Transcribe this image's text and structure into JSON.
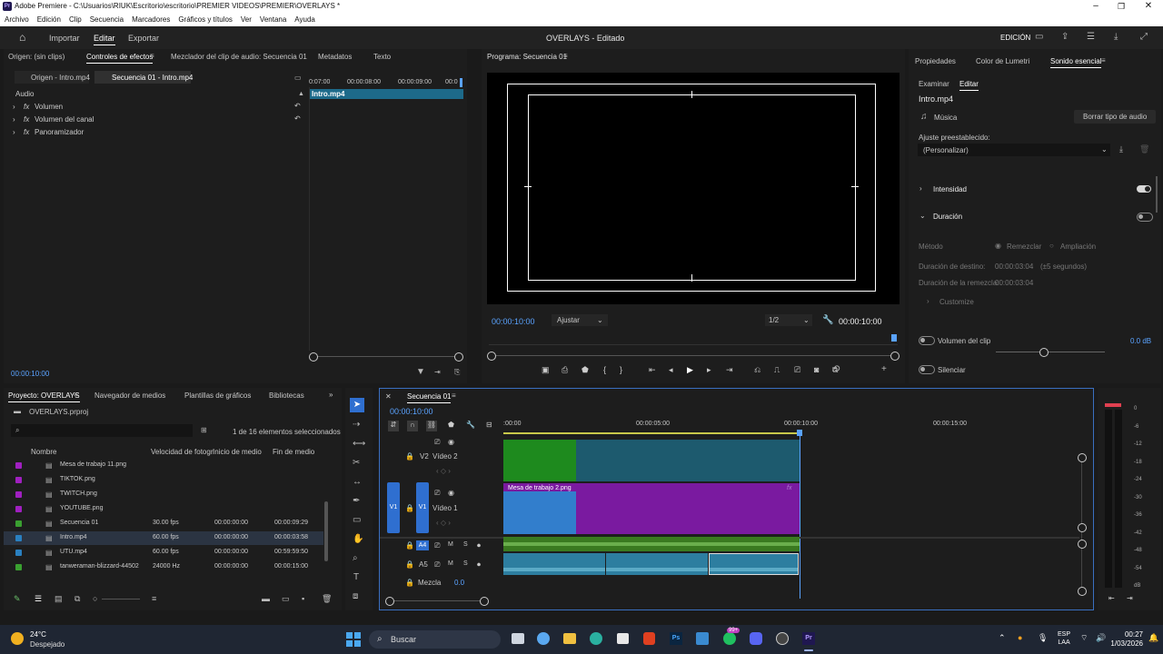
{
  "window": {
    "title": "Adobe Premiere - C:\\Usuarios\\RIUK\\Escritorio\\escritorio\\PREMIER VIDEOS\\PREMIER\\OVERLAYS *",
    "app_icon": "Pr"
  },
  "menu": [
    "Archivo",
    "Edición",
    "Clip",
    "Secuencia",
    "Marcadores",
    "Gráficos y títulos",
    "Ver",
    "Ventana",
    "Ayuda"
  ],
  "header": {
    "home_icon": "home-icon",
    "modes": [
      "Importar",
      "Editar",
      "Exportar"
    ],
    "active_mode": "Editar",
    "project_title": "OVERLAYS - Editado",
    "workspace": "EDICIÓN"
  },
  "source_panel": {
    "tabs": [
      "Origen: (sin clips)",
      "Controles de efectos",
      "Mezclador del clip de audio: Secuencia 01",
      "Metadatos",
      "Texto"
    ],
    "subtabs": [
      "Origen - Intro.mp4",
      "Secuencia 01 - Intro.mp4"
    ],
    "ruler": [
      "0:07:00",
      "00:00:08:00",
      "00:00:09:00",
      "00:0"
    ],
    "clip_label": "Intro.mp4",
    "section": "Audio",
    "effects": [
      "Volumen",
      "Volumen del canal",
      "Panoramizador"
    ],
    "timecode": "00:00:10:00"
  },
  "program_panel": {
    "title": "Programa: Secuencia 01",
    "timecode": "00:00:10:00",
    "fit": "Ajustar",
    "resolution": "1/2",
    "duration": "00:00:10:00"
  },
  "essential_sound": {
    "tabs": [
      "Propiedades",
      "Color de Lumetri",
      "Sonido esencial"
    ],
    "subtabs": [
      "Examinar",
      "Editar"
    ],
    "clip_name": "Intro.mp4",
    "type": "Música",
    "clear_button": "Borrar tipo de audio",
    "preset_label": "Ajuste preestablecido:",
    "preset_value": "(Personalizar)",
    "intensity": "Intensidad",
    "duration": "Duración",
    "method_label": "Método",
    "method_options": [
      "Remezclar",
      "Ampliación"
    ],
    "target_label": "Duración de destino:",
    "target_value": "00:00:03:04",
    "target_hint": "(±5 segundos)",
    "remix_label": "Duración de la remezcla:",
    "remix_value": "00:00:03:04",
    "customize": "Customize",
    "clip_volume": "Volumen del clip",
    "clip_volume_value": "0.0 dB",
    "mute": "Silenciar"
  },
  "project_panel": {
    "tabs": [
      "Proyecto: OVERLAYS",
      "Navegador de medios",
      "Plantillas de gráficos",
      "Bibliotecas"
    ],
    "project_file": "OVERLAYS.prproj",
    "search_placeholder": "",
    "selection": "1 de 16 elementos seleccionados",
    "columns": [
      "Nombre",
      "Velocidad de fotogr",
      "Inicio de medio",
      "Fin de medio"
    ],
    "items": [
      {
        "name": "Mesa de trabajo 11.png",
        "fps": "",
        "start": "",
        "end": "",
        "color": "#a020c0"
      },
      {
        "name": "TIKTOK.png",
        "fps": "",
        "start": "",
        "end": "",
        "color": "#a020c0"
      },
      {
        "name": "TWITCH.png",
        "fps": "",
        "start": "",
        "end": "",
        "color": "#a020c0"
      },
      {
        "name": "YOUTUBE.png",
        "fps": "",
        "start": "",
        "end": "",
        "color": "#a020c0"
      },
      {
        "name": "Secuencia 01",
        "fps": "30.00 fps",
        "start": "00:00:00:00",
        "end": "00:00:09:29",
        "color": "#3aa030"
      },
      {
        "name": "Intro.mp4",
        "fps": "60.00 fps",
        "start": "00:00:00:00",
        "end": "00:00:03:58",
        "color": "#2a80c0"
      },
      {
        "name": "UTU.mp4",
        "fps": "60.00 fps",
        "start": "00:00:00:00",
        "end": "00:59:59:50",
        "color": "#2a80c0"
      },
      {
        "name": "tanweraman-blizzard-44502",
        "fps": "24000 Hz",
        "start": "00:00:00:00",
        "end": "00:00:15:00",
        "color": "#3aa030"
      }
    ]
  },
  "timeline": {
    "title": "Secuencia 01",
    "timecode": "00:00:10:00",
    "ruler": [
      ":00:00",
      "00:00:05:00",
      "00:00:10:00",
      "00:00:15:00"
    ],
    "tracks": {
      "v2": "Vídeo 2",
      "v1": "Vídeo 1",
      "a4": "A4",
      "a5": "A5",
      "v_target": "V1",
      "v_source": "V1",
      "mix": "Mezcla",
      "mix_value": "0.0"
    },
    "clip_v1_label": "Mesa de trabajo 2.png"
  },
  "meter": {
    "scale": [
      "0",
      "-6",
      "-12",
      "-18",
      "-24",
      "-30",
      "-36",
      "-42",
      "-48",
      "-54",
      "dB"
    ]
  },
  "taskbar": {
    "weather_temp": "24°C",
    "weather_text": "Despejado",
    "search": "Buscar",
    "lang": "ESP",
    "lang2": "LAA",
    "time": "00:27",
    "date": "1/03/2026",
    "badge": "99+"
  }
}
